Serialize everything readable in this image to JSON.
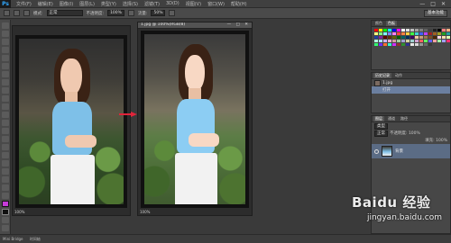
{
  "app": {
    "logo": "Ps"
  },
  "menu": {
    "items": [
      "文件(F)",
      "编辑(E)",
      "图像(I)",
      "图层(L)",
      "类型(Y)",
      "选择(S)",
      "滤镜(T)",
      "3D(D)",
      "视图(V)",
      "窗口(W)",
      "帮助(H)"
    ],
    "window_controls": [
      "—",
      "□",
      "✕"
    ]
  },
  "options": {
    "mode_label": "模式:",
    "mode_value": "正常",
    "opacity_label": "不透明度:",
    "opacity_value": "100%",
    "flow_label": "流量:",
    "flow_value": "50%",
    "workspace": "基本功能"
  },
  "documents": [
    {
      "title": "",
      "zoom": "100%"
    },
    {
      "title": "1.jpg @ 100%(RGB/8)",
      "zoom": "100%"
    }
  ],
  "panels": {
    "swatches_tabs": [
      "颜色",
      "色板"
    ],
    "swatch_colors": [
      "#ff0000",
      "#ffff00",
      "#00ff00",
      "#00ffff",
      "#0000ff",
      "#ff00ff",
      "#ffffff",
      "#e0e0e0",
      "#c0c0c0",
      "#a0a0a0",
      "#808080",
      "#606060",
      "#404040",
      "#202020",
      "#000000",
      "#ff8080",
      "#ffb080",
      "#ffff80",
      "#80ff80",
      "#80ffff",
      "#8080ff",
      "#ff80ff",
      "#ff4040",
      "#ff8040",
      "#ffd040",
      "#40ff40",
      "#40d0d0",
      "#4060ff",
      "#c040ff",
      "#a02020",
      "#a06020",
      "#a0a020",
      "#20a020",
      "#20a0a0",
      "#2040a0",
      "#8020a0",
      "#600000",
      "#603000",
      "#606000",
      "#006000",
      "#006060",
      "#003060",
      "#400060",
      "#f0c8a0",
      "#c8a078",
      "#a07850",
      "#785028",
      "#502800",
      "#ffd8e8",
      "#ffe0b0",
      "#e0ffb0",
      "#b0ffe0",
      "#b0e0ff",
      "#d0b0ff",
      "#ffb0d0",
      "#d0a0a0",
      "#a0d0a0",
      "#a0a0d0",
      "#d0d0a0",
      "#a0d0d0",
      "#d0a0d0",
      "#ff6060",
      "#60ff60",
      "#6060ff",
      "#ffa0a0",
      "#a0ffa0",
      "#a0a0ff",
      "#ff3070",
      "#30ff70",
      "#7030ff",
      "#ff7030",
      "#30ffd0",
      "#d030ff",
      "#903030",
      "#309030",
      "#303090",
      "#e8e8e8",
      "#d8d8d8",
      "#989898",
      "#686868",
      "#383838"
    ],
    "history_tabs": [
      "历史记录",
      "动作"
    ],
    "history": [
      "1.jpg",
      "打开"
    ],
    "layers_tabs": [
      "图层",
      "通道",
      "路径"
    ],
    "layer_kind": "类型",
    "layer_blend": "正常",
    "layer_opacity": "不透明度: 100%",
    "layer_fill": "填充: 100%",
    "layers": [
      "背景"
    ]
  },
  "status": {
    "left": "Mini Bridge",
    "right": "时间轴"
  },
  "watermark": {
    "main": "Baidu 经验",
    "sub": "jingyan.baidu.com"
  }
}
